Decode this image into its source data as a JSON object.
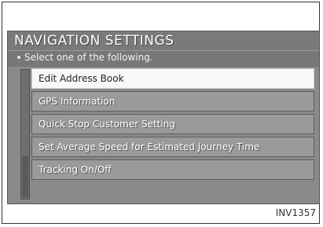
{
  "screen": {
    "title": "NAVIGATION SETTINGS",
    "subtitle": "Select one of the following.",
    "items": [
      {
        "label": "Edit Address Book",
        "selected": true
      },
      {
        "label": "GPS Information",
        "selected": false
      },
      {
        "label": "Quick Stop Customer Setting",
        "selected": false
      },
      {
        "label": "Set Average Speed for Estimated Journey Time",
        "selected": false
      },
      {
        "label": "Tracking On/Off",
        "selected": false
      }
    ]
  },
  "figure_code": "INV1357"
}
